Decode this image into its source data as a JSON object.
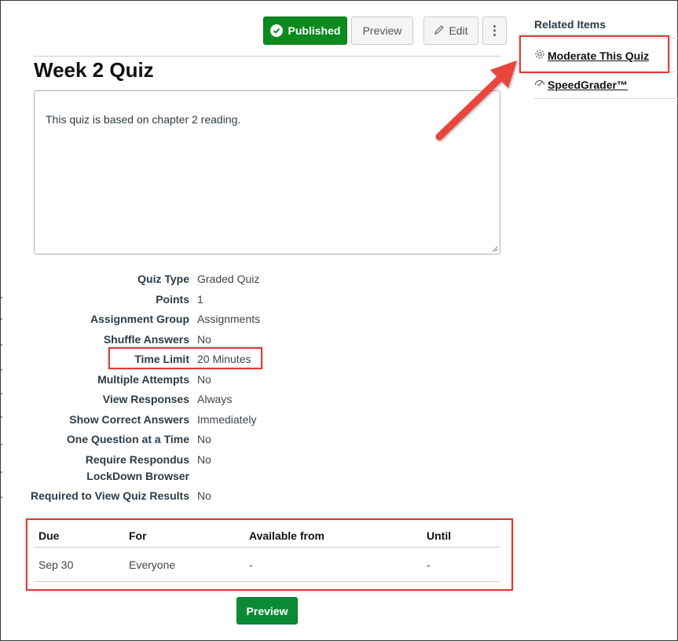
{
  "toolbar": {
    "published_label": "Published",
    "preview_label": "Preview",
    "edit_label": "Edit",
    "more_label": "⋮"
  },
  "quiz": {
    "title": "Week 2 Quiz",
    "description": "This quiz is based on chapter 2 reading."
  },
  "details": [
    {
      "label": "Quiz Type",
      "value": "Graded Quiz"
    },
    {
      "label": "Points",
      "value": "1"
    },
    {
      "label": "Assignment Group",
      "value": "Assignments"
    },
    {
      "label": "Shuffle Answers",
      "value": "No"
    },
    {
      "label": "Time Limit",
      "value": "20 Minutes"
    },
    {
      "label": "Multiple Attempts",
      "value": "No"
    },
    {
      "label": "View Responses",
      "value": "Always"
    },
    {
      "label": "Show Correct Answers",
      "value": "Immediately"
    },
    {
      "label": "One Question at a Time",
      "value": "No"
    },
    {
      "label": "Require Respondus LockDown Browser",
      "value": "No"
    },
    {
      "label": "Required to View Quiz Results",
      "value": "No"
    }
  ],
  "due_table": {
    "headers": [
      "Due",
      "For",
      "Available from",
      "Until"
    ],
    "rows": [
      [
        "Sep 30",
        "Everyone",
        "-",
        "-"
      ]
    ]
  },
  "bottom_preview_label": "Preview",
  "sidebar": {
    "title": "Related Items",
    "items": [
      {
        "label": "Moderate This Quiz",
        "icon": "gear-icon"
      },
      {
        "label": "SpeedGrader™",
        "icon": "speedgrader-icon"
      }
    ]
  },
  "colors": {
    "published_green": "#0b8a1f",
    "preview_green": "#0b8a35",
    "highlight_red": "#e53935"
  }
}
